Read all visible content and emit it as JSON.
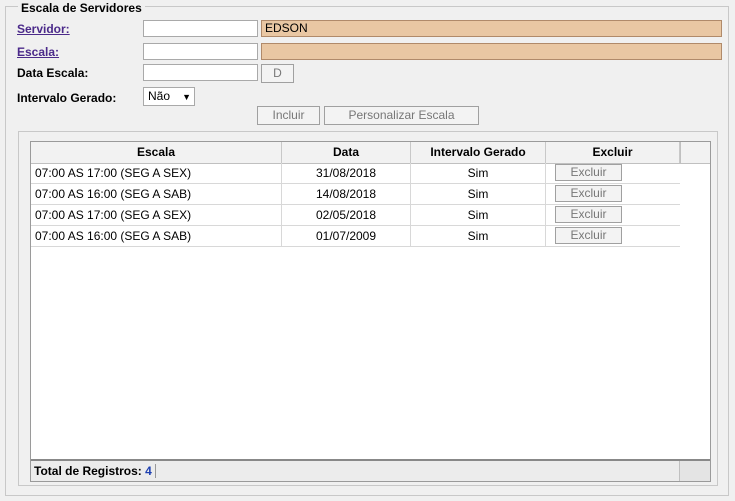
{
  "form": {
    "legend": "Escala de Servidores",
    "servidor_label": "Servidor:",
    "servidor_value": "",
    "servidor_name": "EDSON",
    "escala_label": "Escala:",
    "escala_value": "",
    "escala_desc": "",
    "data_label": "Data Escala:",
    "data_value": "",
    "date_button": "D",
    "intervalo_label": "Intervalo Gerado:",
    "intervalo_selected": "Não",
    "incluir_button": "Incluir",
    "personalizar_button": "Personalizar Escala"
  },
  "grid": {
    "columns": [
      "Escala",
      "Data",
      "Intervalo Gerado",
      "Excluir"
    ],
    "rows": [
      {
        "escala": "07:00 AS 17:00 (SEG A SEX)",
        "data": "31/08/2018",
        "intervalo": "Sim",
        "action": "Excluir"
      },
      {
        "escala": "07:00 AS 16:00 (SEG A SAB)",
        "data": "14/08/2018",
        "intervalo": "Sim",
        "action": "Excluir"
      },
      {
        "escala": "07:00 AS 17:00 (SEG A SEX)",
        "data": "02/05/2018",
        "intervalo": "Sim",
        "action": "Excluir"
      },
      {
        "escala": "07:00 AS 16:00 (SEG A SAB)",
        "data": "01/07/2009",
        "intervalo": "Sim",
        "action": "Excluir"
      }
    ],
    "footer_label": "Total de Registros:",
    "footer_count": "4"
  }
}
